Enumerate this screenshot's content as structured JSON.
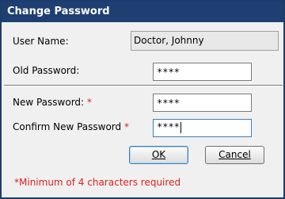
{
  "dialog": {
    "title": "Change Password"
  },
  "fields": {
    "user_name": {
      "label": "User Name:",
      "value": "Doctor, Johnny"
    },
    "old_password": {
      "label": "Old Password:",
      "value": "****"
    },
    "new_password": {
      "label": "New Password:",
      "required_mark": "*",
      "value": "****"
    },
    "confirm_password": {
      "label": "Confirm New Password",
      "required_mark": "*",
      "value": "****"
    }
  },
  "buttons": {
    "ok": "OK",
    "cancel": "Cancel"
  },
  "note": "*Minimum of 4 characters required",
  "colors": {
    "title_bar": "#1f3f73",
    "required": "#e02020"
  }
}
